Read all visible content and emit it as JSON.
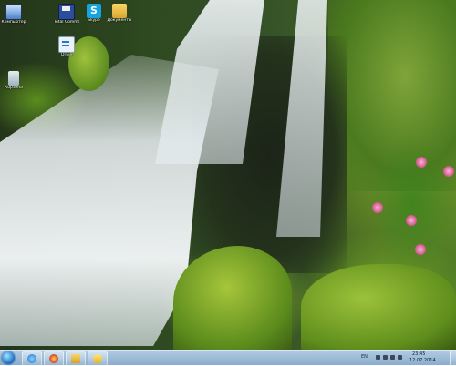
{
  "desktop": {
    "icons": [
      {
        "label": "Компьютер",
        "icon": "computer-icon"
      },
      {
        "label": "Total Commander",
        "icon": "save-disk-icon"
      },
      {
        "label": "Skype",
        "icon": "skype-icon"
      },
      {
        "label": "Документы",
        "icon": "folder-icon"
      },
      {
        "label": "Drive",
        "icon": "document-icon"
      },
      {
        "label": "Корзина",
        "icon": "recycle-bin-icon"
      }
    ]
  },
  "taskbar": {
    "start": "start-orb-icon",
    "pinned": [
      {
        "icon": "internet-explorer-icon"
      },
      {
        "icon": "firefox-icon"
      },
      {
        "icon": "windows-explorer-icon"
      },
      {
        "icon": "media-player-icon"
      }
    ],
    "tray": {
      "language": "EN",
      "time": "23:45",
      "date": "12.07.2014"
    }
  }
}
